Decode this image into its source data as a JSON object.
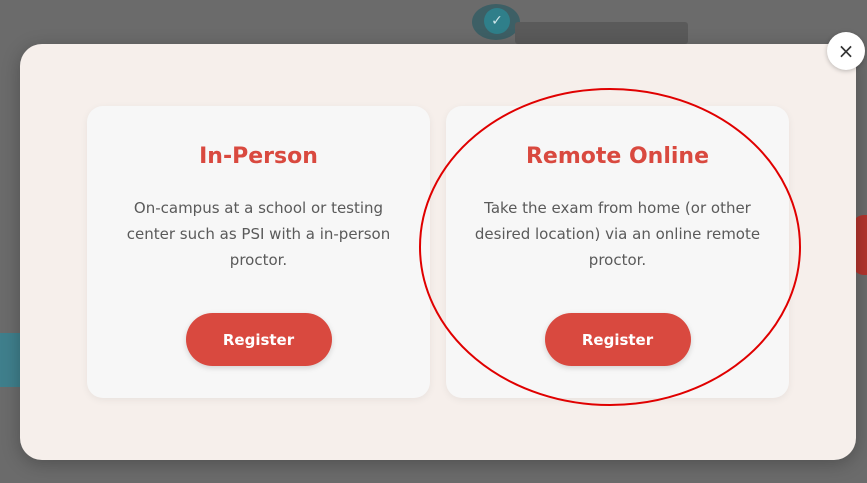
{
  "background": {
    "badge_icon": "check-icon"
  },
  "modal": {
    "close_label": "×",
    "cards": [
      {
        "title": "In-Person",
        "description": "On-campus at a school or testing center such as PSI with a in-person proctor.",
        "button_label": "Register"
      },
      {
        "title": "Remote Online",
        "description": "Take the exam from home (or other desired location) via an online remote proctor.",
        "button_label": "Register"
      }
    ]
  },
  "annotation": {
    "color": "#e00000"
  },
  "colors": {
    "accent": "#d9493f",
    "modal_bg": "#f6efeb",
    "card_bg": "#f7f7f7"
  }
}
